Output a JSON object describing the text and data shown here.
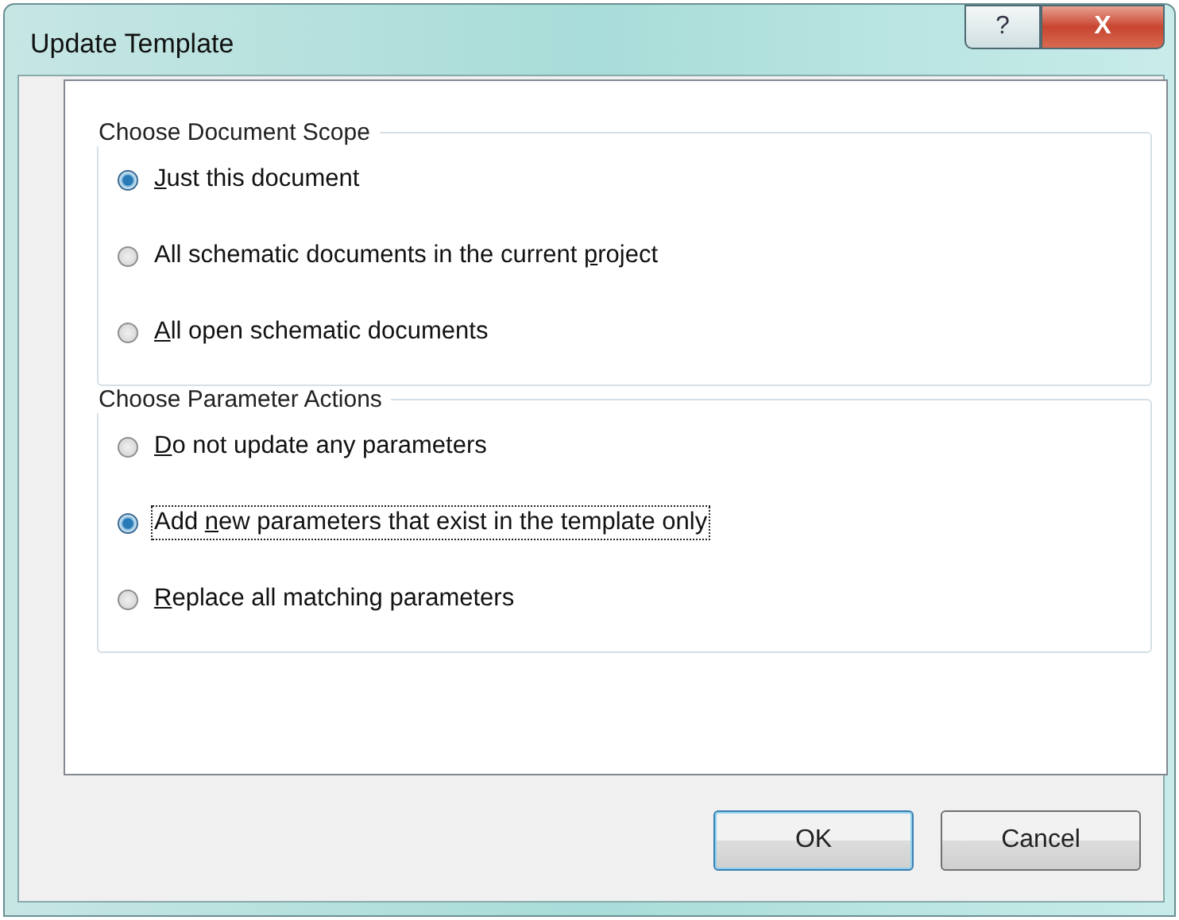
{
  "window": {
    "title": "Update Template",
    "help_button": "?",
    "close_button": "X"
  },
  "groups": [
    {
      "title": "Choose Document Scope",
      "options": [
        {
          "key": "J",
          "after": "ust this document",
          "selected": true,
          "focused": false
        },
        {
          "before": "All schematic documents in the current ",
          "key": "p",
          "after": "roject",
          "selected": false,
          "focused": false
        },
        {
          "key": "A",
          "after": "ll open schematic documents",
          "selected": false,
          "focused": false
        }
      ]
    },
    {
      "title": "Choose Parameter Actions",
      "options": [
        {
          "key": "D",
          "after": "o not update any parameters",
          "selected": false,
          "focused": false
        },
        {
          "before": "Add ",
          "key": "n",
          "after": "ew parameters that exist in the template only",
          "selected": true,
          "focused": true
        },
        {
          "key": "R",
          "after": "eplace all matching parameters",
          "selected": false,
          "focused": false
        }
      ]
    }
  ],
  "buttons": [
    {
      "label": "OK",
      "default": true
    },
    {
      "label": "Cancel",
      "default": false
    }
  ]
}
